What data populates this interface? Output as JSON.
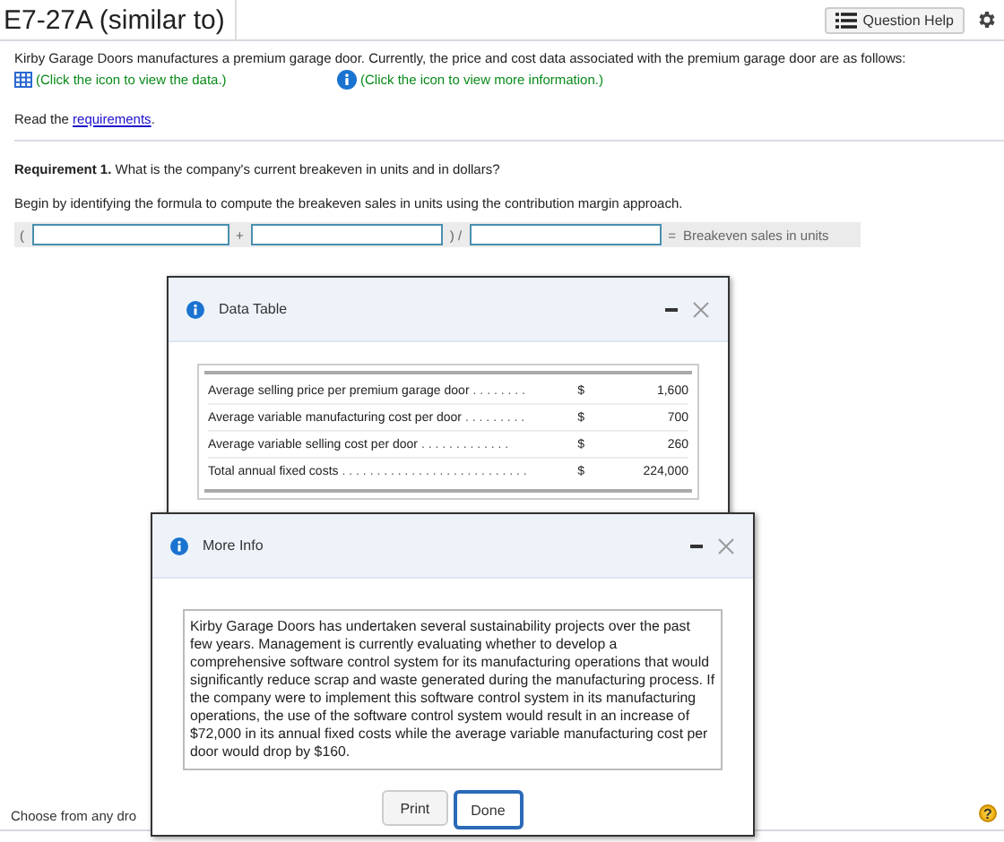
{
  "header": {
    "title": "E7-27A (similar to)",
    "help_button": "Question Help"
  },
  "intro": "Kirby Garage Doors manufactures a premium garage door. Currently, the price and cost data associated with the premium garage door are as follows:",
  "links": [
    {
      "kind": "table",
      "label": "(Click the icon to view the data.)"
    },
    {
      "kind": "info",
      "label": "(Click the icon to view more information.)"
    }
  ],
  "read": {
    "prefix": "Read the ",
    "link": "requirements",
    "suffix": "."
  },
  "requirement": {
    "label": "Requirement 1.",
    "question": "What is the company's current breakeven in units and in dollars?"
  },
  "instruction": "Begin by identifying the formula to compute the breakeven sales in units using the contribution margin approach.",
  "formula": {
    "open": "(",
    "plus": "+",
    "close": ") /",
    "equals": "=",
    "result": "Breakeven sales in units"
  },
  "footer": {
    "prompt": "Choose from any dro",
    "help": "?"
  },
  "data_table": {
    "title": "Data Table",
    "rows": [
      {
        "label": "Average selling price per premium garage door",
        "leader": ". . . . . . . .",
        "currency": "$",
        "value": "1,600"
      },
      {
        "label": "Average variable manufacturing cost per door",
        "leader": ". . . . . . . . .",
        "currency": "$",
        "value": "700"
      },
      {
        "label": "Average variable selling cost per door",
        "leader": ". . . . . . . . . . . . .",
        "currency": "$",
        "value": "260"
      },
      {
        "label": "Total annual fixed costs",
        "leader": ". . . . . . . . . . . . . . . . . . . . . . . . . . .",
        "currency": "$",
        "value": "224,000"
      }
    ]
  },
  "more_info": {
    "title": "More Info",
    "text": "Kirby Garage Doors has undertaken several sustainability projects over the past few years. Management is currently evaluating whether to develop a comprehensive software control system for its manufacturing operations that would significantly reduce scrap and waste generated during the manufacturing process. If the company were to implement this software control system in its manufacturing operations, the use of the software control system would result in an increase of $72,000 in its annual fixed costs while the average variable manufacturing cost per door would drop by $160.",
    "buttons": [
      {
        "label": "Print",
        "selected": false
      },
      {
        "label": "Done",
        "selected": true
      }
    ]
  }
}
